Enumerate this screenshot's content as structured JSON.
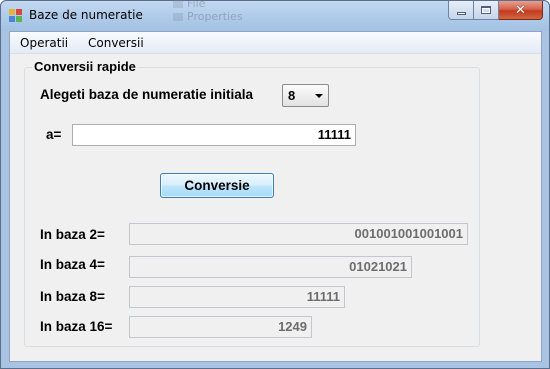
{
  "window": {
    "title": "Baze de numeratie",
    "ghost_text_1": "File",
    "ghost_text_2": "Properties",
    "colors": {
      "title_gradient_top": "#c3d8f0",
      "close_button": "#c13c21",
      "client_bg": "#f0f0f0"
    }
  },
  "menu": {
    "items": [
      {
        "label": "Operatii"
      },
      {
        "label": "Conversii"
      }
    ]
  },
  "group": {
    "title": "Conversii rapide",
    "base_prompt": "Alegeti baza de numeratie initiala",
    "base_selected": "8",
    "input_label": "a=",
    "input_value": "11111",
    "convert_button": "Conversie"
  },
  "results": [
    {
      "label": "In baza 2=",
      "value": "001001001001001"
    },
    {
      "label": "In baza 4=",
      "value": "01021021"
    },
    {
      "label": "In baza 8=",
      "value": "11111"
    },
    {
      "label": "In baza 16=",
      "value": "1249"
    }
  ]
}
